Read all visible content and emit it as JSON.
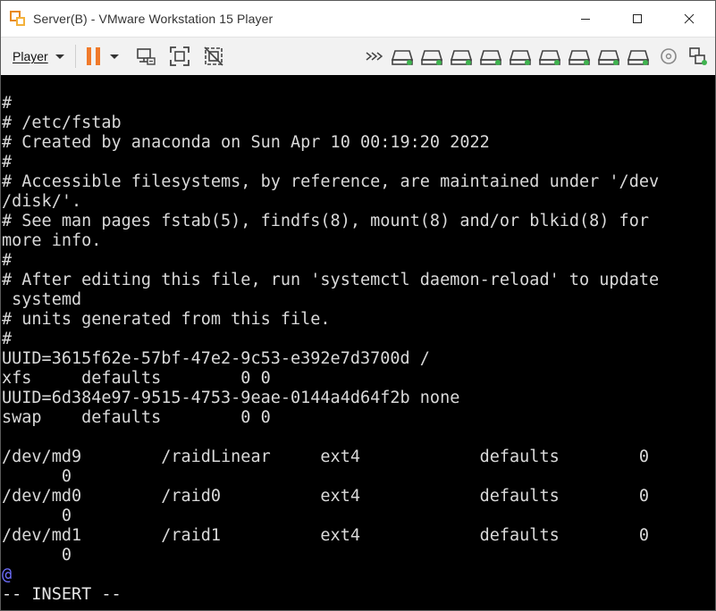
{
  "window": {
    "title": "Server(B) - VMware Workstation 15 Player"
  },
  "toolbar": {
    "player_label": "Player"
  },
  "colors": {
    "pause_orange": "#f07a2b",
    "device_green": "#3fb34f",
    "terminal_bg": "#000000",
    "terminal_fg": "#d9d9d9",
    "cursor_blue": "#6f6fff"
  },
  "terminal": {
    "lines": [
      "#",
      "# /etc/fstab",
      "# Created by anaconda on Sun Apr 10 00:19:20 2022",
      "#",
      "# Accessible filesystems, by reference, are maintained under '/dev",
      "/disk/'.",
      "# See man pages fstab(5), findfs(8), mount(8) and/or blkid(8) for",
      "more info.",
      "#",
      "# After editing this file, run 'systemctl daemon-reload' to update",
      " systemd",
      "# units generated from this file.",
      "#",
      "UUID=3615f62e-57bf-47e2-9c53-e392e7d3700d /",
      "xfs     defaults        0 0",
      "UUID=6d384e97-9515-4753-9eae-0144a4d64f2b none",
      "swap    defaults        0 0",
      "",
      "/dev/md9        /raidLinear     ext4            defaults        0",
      "      0",
      "/dev/md0        /raid0          ext4            defaults        0",
      "      0",
      "/dev/md1        /raid1          ext4            defaults        0",
      "      0"
    ],
    "cursor_line": "@",
    "status": "-- INSERT --"
  }
}
